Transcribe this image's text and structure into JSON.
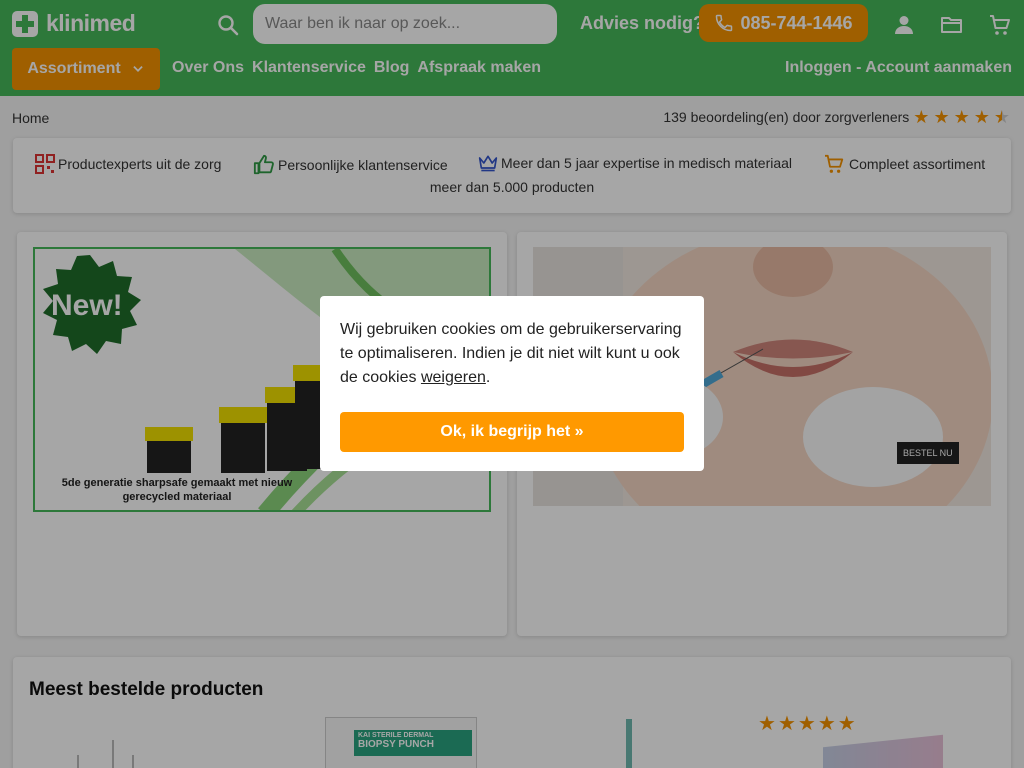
{
  "header": {
    "logo_text": "klinimed",
    "search_placeholder": "Waar ben ik naar op zoek...",
    "advies_label": "Advies nodig?",
    "phone": "085-744-1446",
    "assortiment_label": "Assortiment",
    "nav": [
      "Over Ons",
      "Klantenservice",
      "Blog",
      "Afspraak maken"
    ],
    "login_label": "Inloggen - Account aanmaken"
  },
  "breadcrumb": "Home",
  "rating": {
    "text": "139 beoordeling(en) door zorgverleners",
    "stars": 4.5
  },
  "usps": [
    "Productexperts uit de zorg",
    "Persoonlijke klantenservice",
    "Meer dan 5 jaar expertise in medisch materiaal",
    "Compleet assortiment"
  ],
  "usp_line2": "meer dan 5.000 producten",
  "banner1": {
    "badge": "New!",
    "caption": "5de generatie sharpsafe gemaakt met nieuw gerecycled materiaal"
  },
  "banner2": {
    "cta": "BESTEL NU"
  },
  "products": {
    "title": "Meest bestelde producten",
    "box_label_1": "BIOPSY PUNCH",
    "box_label_2": "KAI STERILE DERMAL",
    "product_stars": 5
  },
  "cookie": {
    "text_before": "Wij gebruiken cookies om de gebruikerservaring te optimaliseren. Indien je dit niet wilt kunt u ook de cookies ",
    "link": "weigeren",
    "text_after": ".",
    "button": "Ok, ik begrijp het »"
  },
  "colors": {
    "green": "#46b85a",
    "orange": "#f59300",
    "button_orange": "#ff9900"
  },
  "icons": [
    "search-icon",
    "phone-icon",
    "user-icon",
    "folder-icon",
    "cart-icon",
    "chevron-down-icon",
    "qr-icon",
    "thumbs-up-icon",
    "crown-icon",
    "cart-icon",
    "star-icon"
  ]
}
